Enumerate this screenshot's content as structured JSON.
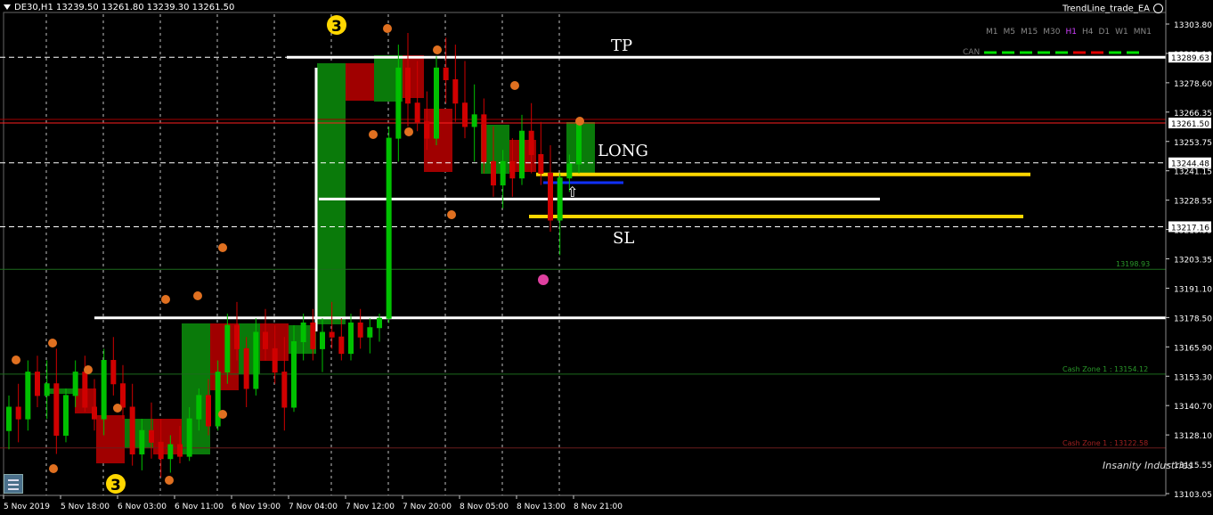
{
  "header": {
    "symbol_info": "DE30,H1  13239.50 13261.80 13239.30 13261.50",
    "ea_name": "TrendLine_trade_EA"
  },
  "timeframes": [
    "M1",
    "M5",
    "M15",
    "M30",
    "H1",
    "H4",
    "D1",
    "W1",
    "MN1"
  ],
  "active_timeframe": "H1",
  "can_label": "CAN",
  "annotations": {
    "tp": "TP",
    "long": "LONG",
    "sl": "SL",
    "wave_top": "3",
    "wave_bottom": "3",
    "arrow": "⇧"
  },
  "zones": {
    "level_198": "13198.93",
    "cash_zone_green": "Cash Zone 1 : 13154.12",
    "cash_zone_red": "Cash Zone 1 : 13122.58"
  },
  "price_axis": {
    "labels": [
      "13303.80",
      "13291.10",
      "13278.60",
      "13266.35",
      "13253.75",
      "13241.15",
      "13228.55",
      "13215.95",
      "13203.35",
      "13191.10",
      "13178.50",
      "13165.90",
      "13153.30",
      "13140.70",
      "13128.10",
      "13115.55",
      "13103.05"
    ],
    "highlighted": [
      {
        "text": "13289.63",
        "bg": "#ffffff",
        "fg": "#000000"
      },
      {
        "text": "13261.50",
        "bg": "#ffffff",
        "fg": "#000000"
      },
      {
        "text": "13244.48",
        "bg": "#ffffff",
        "fg": "#000000"
      },
      {
        "text": "13217.16",
        "bg": "#ffffff",
        "fg": "#000000"
      }
    ]
  },
  "time_axis": [
    "5 Nov 2019",
    "5 Nov 18:00",
    "6 Nov 03:00",
    "6 Nov 11:00",
    "6 Nov 19:00",
    "7 Nov 04:00",
    "7 Nov 12:00",
    "7 Nov 20:00",
    "8 Nov 05:00",
    "8 Nov 13:00",
    "8 Nov 21:00"
  ],
  "logo_text": "Insanity Industries",
  "colors": {
    "bull": "#00c000",
    "bear": "#d00000",
    "bull_block": "#0a7a0a",
    "bear_block": "#a00000",
    "gold": "#ffd700",
    "blue": "#1030ff",
    "bid_line": "#ff2020",
    "marker": "#e07020"
  },
  "chart_data": {
    "type": "candlestick",
    "symbol": "DE30",
    "timeframe": "H1",
    "ylim": [
      13103.05,
      13303.8
    ],
    "horizontal_levels": {
      "tp": 13289.63,
      "bid": 13261.5,
      "entry": 13244.48,
      "sl": 13217.16,
      "zone_198": 13198.93,
      "cash_green": 13154.12,
      "cash_red": 13122.58,
      "white_entry_line": 13229.0,
      "white_low_line": 13178.2,
      "gold_upper": 13239.5,
      "gold_lower": 13221.5,
      "blue_line": 13236.0
    },
    "candles": [
      [
        13130,
        13145,
        13122,
        13140
      ],
      [
        13140,
        13150,
        13125,
        13135
      ],
      [
        13135,
        13160,
        13130,
        13155
      ],
      [
        13155,
        13162,
        13140,
        13145
      ],
      [
        13145,
        13160,
        13135,
        13150
      ],
      [
        13150,
        13165,
        13120,
        13128
      ],
      [
        13128,
        13148,
        13125,
        13145
      ],
      [
        13145,
        13160,
        13140,
        13155
      ],
      [
        13155,
        13162,
        13138,
        13140
      ],
      [
        13140,
        13152,
        13130,
        13135
      ],
      [
        13135,
        13165,
        13128,
        13160
      ],
      [
        13160,
        13170,
        13145,
        13150
      ],
      [
        13150,
        13158,
        13135,
        13140
      ],
      [
        13140,
        13150,
        13115,
        13120
      ],
      [
        13120,
        13135,
        13113,
        13130
      ],
      [
        13130,
        13142,
        13118,
        13125
      ],
      [
        13125,
        13135,
        13110,
        13118
      ],
      [
        13118,
        13128,
        13112,
        13124
      ],
      [
        13124,
        13132,
        13116,
        13119
      ],
      [
        13119,
        13140,
        13117,
        13135
      ],
      [
        13135,
        13148,
        13130,
        13145
      ],
      [
        13145,
        13152,
        13128,
        13132
      ],
      [
        13132,
        13160,
        13130,
        13155
      ],
      [
        13155,
        13180,
        13150,
        13175
      ],
      [
        13175,
        13185,
        13160,
        13165
      ],
      [
        13165,
        13170,
        13140,
        13148
      ],
      [
        13148,
        13178,
        13145,
        13172
      ],
      [
        13172,
        13182,
        13160,
        13165
      ],
      [
        13165,
        13175,
        13150,
        13155
      ],
      [
        13155,
        13170,
        13130,
        13140
      ],
      [
        13140,
        13175,
        13138,
        13168
      ],
      [
        13168,
        13180,
        13160,
        13176
      ],
      [
        13176,
        13182,
        13160,
        13165
      ],
      [
        13165,
        13178,
        13155,
        13172
      ],
      [
        13172,
        13185,
        13165,
        13170
      ],
      [
        13170,
        13178,
        13160,
        13163
      ],
      [
        13163,
        13180,
        13160,
        13176
      ],
      [
        13176,
        13182,
        13165,
        13170
      ],
      [
        13170,
        13178,
        13163,
        13174
      ],
      [
        13174,
        13180,
        13168,
        13178
      ],
      [
        13178,
        13260,
        13176,
        13255
      ],
      [
        13255,
        13295,
        13245,
        13285
      ],
      [
        13285,
        13300,
        13260,
        13270
      ],
      [
        13270,
        13288,
        13258,
        13262
      ],
      [
        13262,
        13275,
        13250,
        13255
      ],
      [
        13255,
        13290,
        13252,
        13285
      ],
      [
        13285,
        13298,
        13270,
        13280
      ],
      [
        13280,
        13295,
        13262,
        13270
      ],
      [
        13270,
        13288,
        13255,
        13260
      ],
      [
        13260,
        13278,
        13245,
        13265
      ],
      [
        13265,
        13272,
        13240,
        13245
      ],
      [
        13245,
        13260,
        13230,
        13235
      ],
      [
        13235,
        13250,
        13225,
        13245
      ],
      [
        13245,
        13255,
        13230,
        13238
      ],
      [
        13238,
        13265,
        13235,
        13258
      ],
      [
        13258,
        13270,
        13240,
        13248
      ],
      [
        13248,
        13262,
        13235,
        13240
      ],
      [
        13240,
        13252,
        13215,
        13220
      ],
      [
        13220,
        13240,
        13205,
        13238
      ],
      [
        13238,
        13248,
        13232,
        13244
      ],
      [
        13244,
        13262,
        13240,
        13261
      ]
    ],
    "price_labels_visible": [
      "13303.80",
      "13291.10",
      "13278.60",
      "13266.35",
      "13253.75",
      "13241.15",
      "13228.55",
      "13215.95",
      "13203.35",
      "13191.10",
      "13178.50",
      "13165.90",
      "13153.30",
      "13140.70",
      "13128.10",
      "13115.55",
      "13103.05"
    ]
  }
}
